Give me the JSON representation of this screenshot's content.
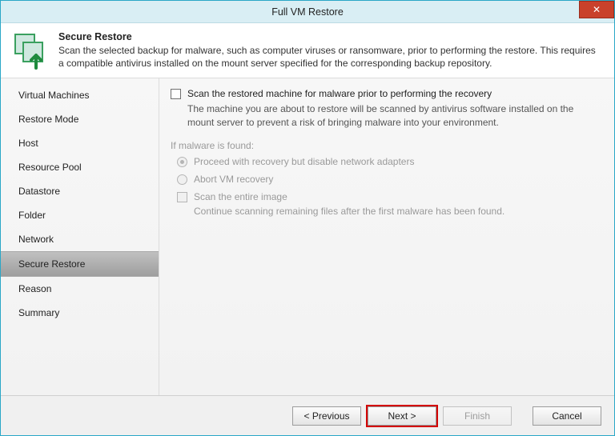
{
  "window": {
    "title": "Full VM Restore",
    "close": "✕"
  },
  "header": {
    "heading": "Secure Restore",
    "desc": "Scan the selected backup for malware, such as computer viruses or ransomware, prior to performing the restore. This requires a compatible antivirus installed on the mount server specified for the corresponding backup repository."
  },
  "sidebar": {
    "items": [
      {
        "label": "Virtual Machines"
      },
      {
        "label": "Restore Mode"
      },
      {
        "label": "Host"
      },
      {
        "label": "Resource Pool"
      },
      {
        "label": "Datastore"
      },
      {
        "label": "Folder"
      },
      {
        "label": "Network"
      },
      {
        "label": "Secure Restore"
      },
      {
        "label": "Reason"
      },
      {
        "label": "Summary"
      }
    ],
    "selected_index": 7
  },
  "content": {
    "scan_label": "Scan the restored machine for malware prior to performing the recovery",
    "scan_desc": "The machine you are about to restore will be scanned by antivirus software installed on the mount server to prevent a risk of bringing malware into your environment.",
    "ifmalware_title": "If malware is found:",
    "radio1": "Proceed with recovery but disable network adapters",
    "radio2": "Abort VM recovery",
    "entire_label": "Scan the entire image",
    "entire_desc": "Continue scanning remaining files after the first malware has been found."
  },
  "footer": {
    "previous": "< Previous",
    "next": "Next >",
    "finish": "Finish",
    "cancel": "Cancel"
  }
}
